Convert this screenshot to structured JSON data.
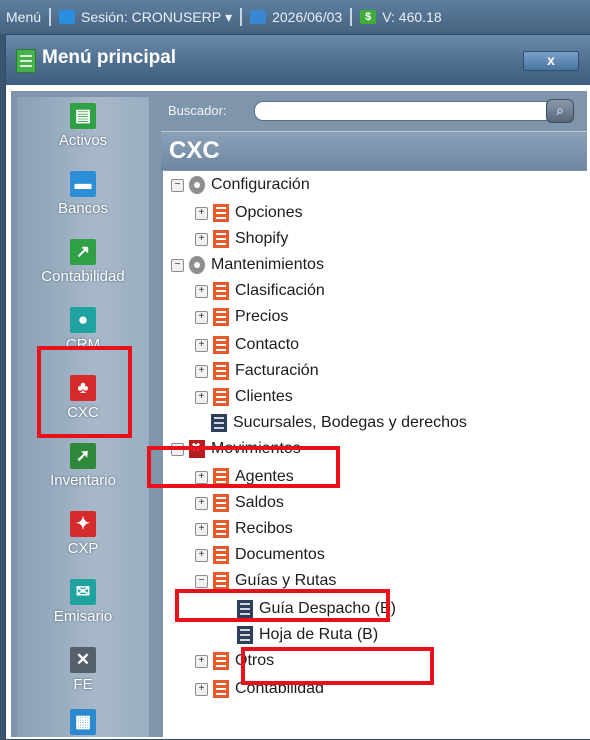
{
  "topbar": {
    "menu": "Menú",
    "session": "Sesión: CRONUSERP",
    "date": "2026/06/03",
    "version": "V: 460.18"
  },
  "window": {
    "title": "Menú principal",
    "close_label": "x"
  },
  "modules": [
    {
      "label": "Activos"
    },
    {
      "label": "Bancos"
    },
    {
      "label": "Contabilidad"
    },
    {
      "label": "CRM"
    },
    {
      "label": "CXC"
    },
    {
      "label": "Inventario"
    },
    {
      "label": "CXP"
    },
    {
      "label": "Emisario"
    },
    {
      "label": "FE"
    }
  ],
  "search": {
    "label": "Buscador:",
    "value": "",
    "placeholder": ""
  },
  "section_title": "CXC",
  "tree": [
    {
      "label": "Configuración"
    },
    {
      "label": "Opciones"
    },
    {
      "label": "Shopify"
    },
    {
      "label": "Mantenimientos"
    },
    {
      "label": "Clasificación"
    },
    {
      "label": "Precios"
    },
    {
      "label": "Contacto"
    },
    {
      "label": "Facturación"
    },
    {
      "label": "Clientes"
    },
    {
      "label": "Sucursales, Bodegas y derechos"
    },
    {
      "label": "Movimientos"
    },
    {
      "label": "Agentes"
    },
    {
      "label": "Saldos"
    },
    {
      "label": "Recibos"
    },
    {
      "label": "Documentos"
    },
    {
      "label": "Guías y Rutas"
    },
    {
      "label": "Guía Despacho (B)"
    },
    {
      "label": "Hoja de Ruta (B)"
    },
    {
      "label": "Otros"
    },
    {
      "label": "Contabilidad"
    }
  ],
  "colors": {
    "highlight": "#e8101a",
    "list_icon": "#e85a2a",
    "header": "#6f88a1"
  }
}
